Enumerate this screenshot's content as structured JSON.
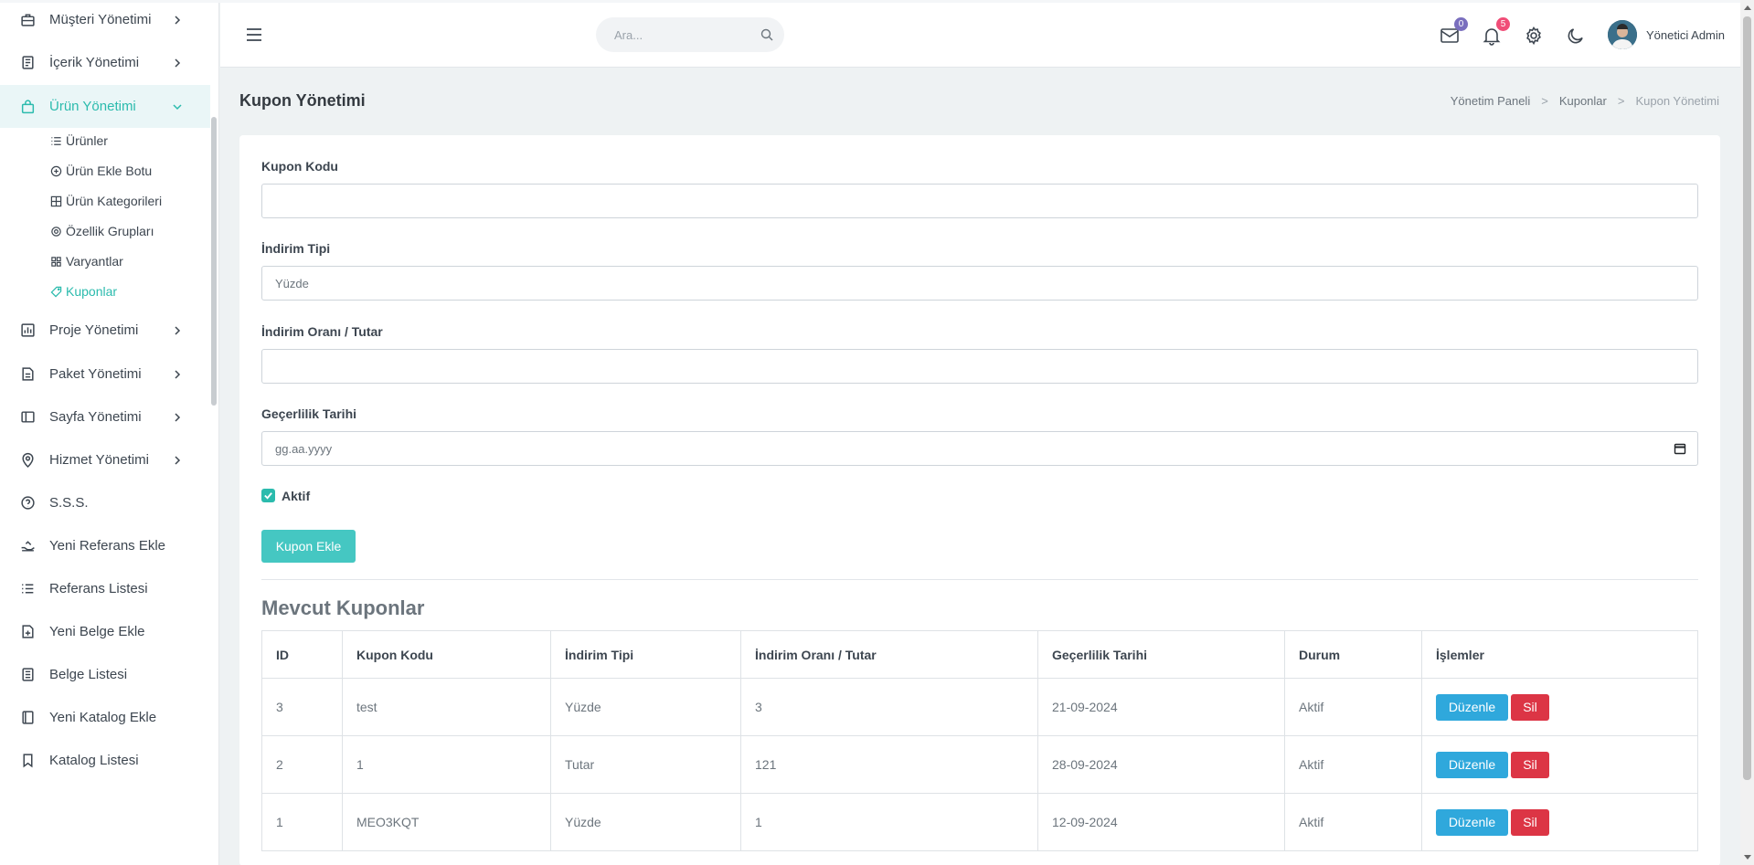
{
  "sidebar": {
    "items": [
      {
        "label": "Müşteri Yönetimi"
      },
      {
        "label": "İçerik Yönetimi"
      },
      {
        "label": "Ürün Yönetimi"
      },
      {
        "label": "Proje Yönetimi"
      },
      {
        "label": "Paket Yönetimi"
      },
      {
        "label": "Sayfa Yönetimi"
      },
      {
        "label": "Hizmet Yönetimi"
      },
      {
        "label": "S.S.S."
      },
      {
        "label": "Yeni Referans Ekle"
      },
      {
        "label": "Referans Listesi"
      },
      {
        "label": "Yeni Belge Ekle"
      },
      {
        "label": "Belge Listesi"
      },
      {
        "label": "Yeni Katalog Ekle"
      },
      {
        "label": "Katalog Listesi"
      }
    ],
    "sub_items": [
      {
        "label": "Ürünler"
      },
      {
        "label": "Ürün Ekle Botu"
      },
      {
        "label": "Ürün Kategorileri"
      },
      {
        "label": "Özellik Grupları"
      },
      {
        "label": "Varyantlar"
      },
      {
        "label": "Kuponlar"
      }
    ]
  },
  "topbar": {
    "search_placeholder": "Ara...",
    "mail_badge": "0",
    "notif_badge": "5",
    "user_name": "Yönetici Admin"
  },
  "page": {
    "title": "Kupon Yönetimi",
    "breadcrumb": [
      "Yönetim Paneli",
      "Kuponlar",
      "Kupon Yönetimi"
    ]
  },
  "form": {
    "code_label": "Kupon Kodu",
    "code_value": "",
    "type_label": "İndirim Tipi",
    "type_value": "Yüzde",
    "amount_label": "İndirim Oranı / Tutar",
    "amount_value": "",
    "date_label": "Geçerlilik Tarihi",
    "date_placeholder": "gg.aa.yyyy",
    "active_label": "Aktif",
    "submit_label": "Kupon Ekle"
  },
  "table": {
    "section_title": "Mevcut Kuponlar",
    "headers": [
      "ID",
      "Kupon Kodu",
      "İndirim Tipi",
      "İndirim Oranı / Tutar",
      "Geçerlilik Tarihi",
      "Durum",
      "İşlemler"
    ],
    "rows": [
      {
        "id": "3",
        "code": "test",
        "type": "Yüzde",
        "amount": "3",
        "date": "21-09-2024",
        "status": "Aktif"
      },
      {
        "id": "2",
        "code": "1",
        "type": "Tutar",
        "amount": "121",
        "date": "28-09-2024",
        "status": "Aktif"
      },
      {
        "id": "1",
        "code": "MEO3KQT",
        "type": "Yüzde",
        "amount": "1",
        "date": "12-09-2024",
        "status": "Aktif"
      }
    ],
    "edit_label": "Düzenle",
    "delete_label": "Sil"
  },
  "colors": {
    "accent": "#2bbbad",
    "edit_button": "#2fa8dc",
    "delete_button": "#dc3545"
  }
}
